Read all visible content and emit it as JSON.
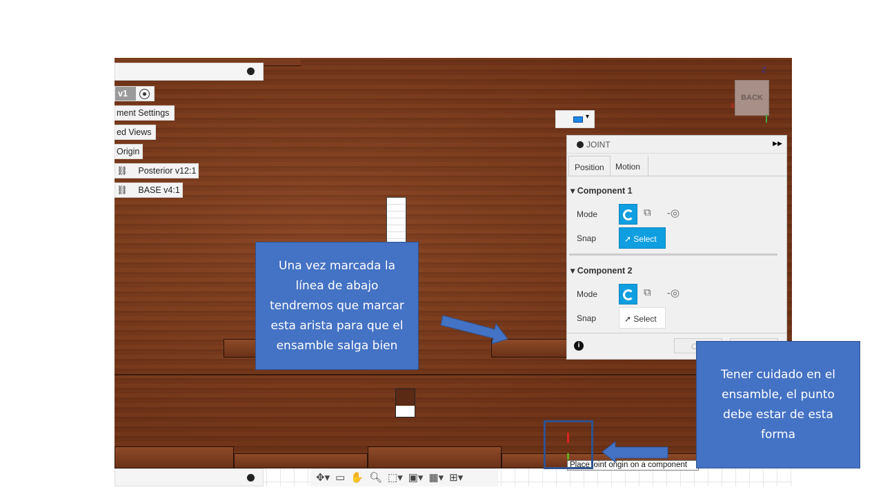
{
  "browser": {
    "root_label": "v1",
    "items": [
      {
        "label": "ment Settings"
      },
      {
        "label": "ed Views"
      },
      {
        "label": "Origin"
      },
      {
        "label": "Posterior v12:1",
        "icon": "link-icon"
      },
      {
        "label": "BASE v4:1",
        "icon": "link-icon"
      }
    ]
  },
  "viewcube": {
    "face": "BACK",
    "axes": [
      "Z",
      "X",
      "Y"
    ]
  },
  "joint_panel": {
    "title": "JOINT",
    "tabs": [
      {
        "label": "Position",
        "active": true
      },
      {
        "label": "Motion",
        "active": false
      }
    ],
    "component1": {
      "title": "Component 1",
      "mode_label": "Mode",
      "snap_label": "Snap",
      "select_label": "Select"
    },
    "component2": {
      "title": "Component 2",
      "mode_label": "Mode",
      "snap_label": "Snap",
      "select_label": "Select"
    },
    "ok_partial": "O"
  },
  "tooltip": "Place joint origin on a component",
  "callouts": {
    "left": "Una vez marcada la línea de abajo tendremos que marcar esta arista para que el ensamble salga bien",
    "right": "Tener cuidado en el ensamble, el punto debe estar de esta forma"
  },
  "colors": {
    "callout": "#4472c4",
    "accent": "#0f9ee0"
  }
}
